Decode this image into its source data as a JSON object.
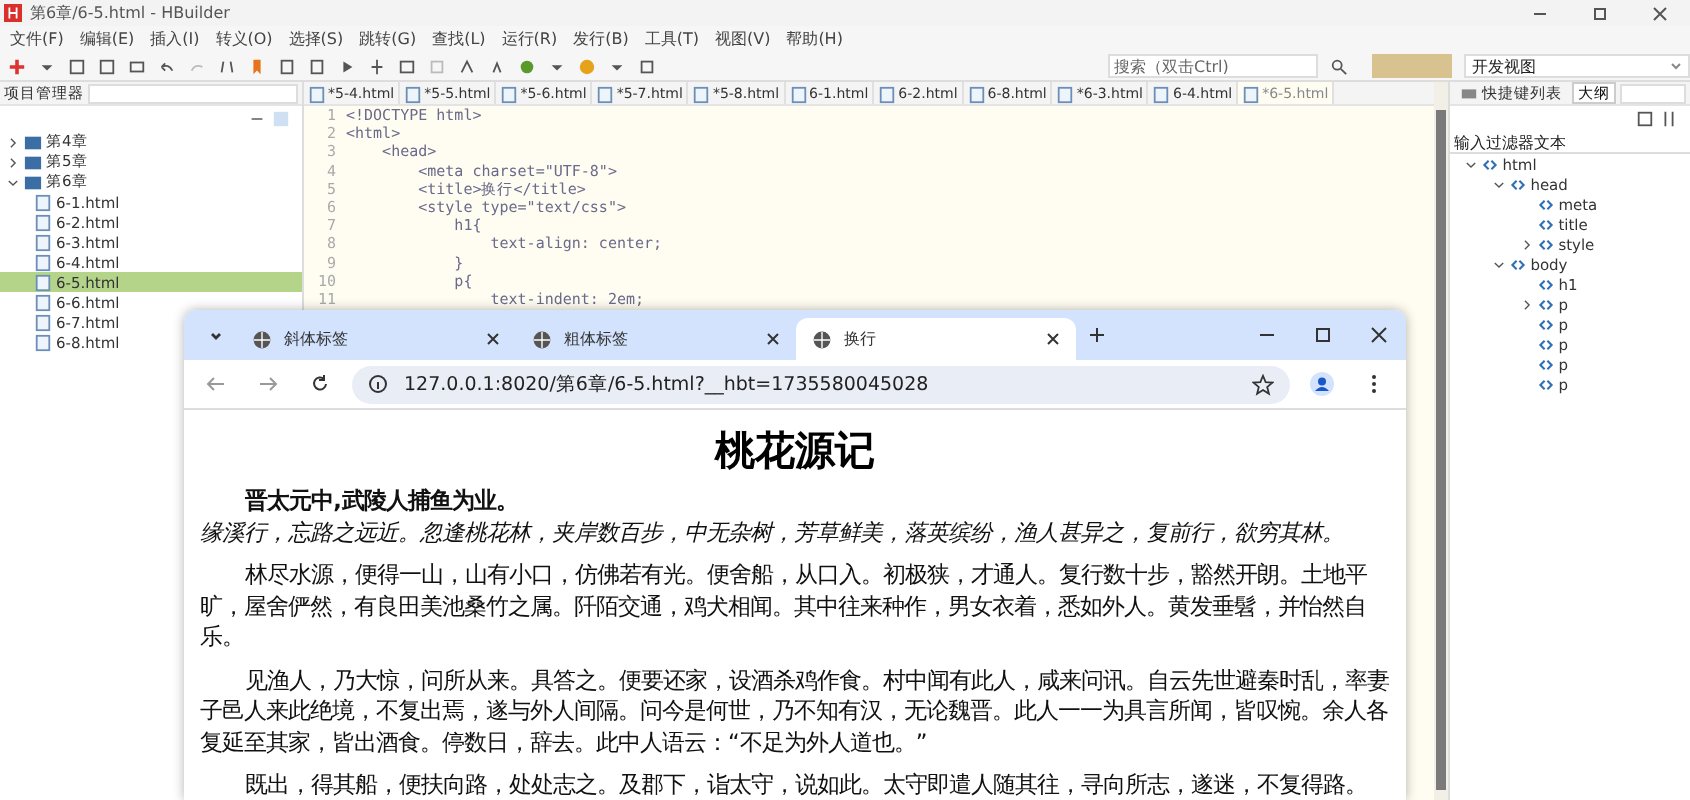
{
  "window": {
    "title": "第6章/6-5.html - HBuilder"
  },
  "menu": [
    "文件(F)",
    "编辑(E)",
    "插入(I)",
    "转义(O)",
    "选择(S)",
    "跳转(G)",
    "查找(L)",
    "运行(R)",
    "发行(B)",
    "工具(T)",
    "视图(V)",
    "帮助(H)"
  ],
  "toolbar": {
    "search": {
      "placeholder": "搜索（双击Ctrl)"
    },
    "view": "开发视图"
  },
  "project": {
    "title": "项目管理器",
    "tree": [
      {
        "label": "第4章",
        "expanded": false,
        "selected": false
      },
      {
        "label": "第5章",
        "expanded": false,
        "selected": false
      },
      {
        "label": "第6章",
        "expanded": true,
        "selected": false,
        "children": [
          {
            "label": "6-1.html",
            "selected": false
          },
          {
            "label": "6-2.html",
            "selected": false
          },
          {
            "label": "6-3.html",
            "selected": false
          },
          {
            "label": "6-4.html",
            "selected": false
          },
          {
            "label": "6-5.html",
            "selected": true
          },
          {
            "label": "6-6.html",
            "selected": false
          },
          {
            "label": "6-7.html",
            "selected": false
          },
          {
            "label": "6-8.html",
            "selected": false
          }
        ]
      }
    ]
  },
  "editor_tabs": [
    {
      "label": "*5-4.html",
      "selected": false
    },
    {
      "label": "*5-5.html",
      "selected": false
    },
    {
      "label": "*5-6.html",
      "selected": false
    },
    {
      "label": "*5-7.html",
      "selected": false
    },
    {
      "label": "*5-8.html",
      "selected": false
    },
    {
      "label": "6-1.html",
      "selected": false
    },
    {
      "label": "6-2.html",
      "selected": false
    },
    {
      "label": "6-8.html",
      "selected": false
    },
    {
      "label": "*6-3.html",
      "selected": false
    },
    {
      "label": "6-4.html",
      "selected": false
    },
    {
      "label": "*6-5.html",
      "selected": true
    }
  ],
  "code_lines": [
    {
      "number": "1",
      "text": "<!DOCTYPE html>"
    },
    {
      "number": "2",
      "text": "<html>"
    },
    {
      "number": "3",
      "text": "    <head>"
    },
    {
      "number": "4",
      "text": "        <meta charset=\"UTF-8\">"
    },
    {
      "number": "5",
      "text": "        <title>换行</title>"
    },
    {
      "number": "6",
      "text": "        <style type=\"text/css\">"
    },
    {
      "number": "7",
      "text": "            h1{"
    },
    {
      "number": "8",
      "text": "                text-align: center;"
    },
    {
      "number": "9",
      "text": "            }"
    },
    {
      "number": "10",
      "text": "            p{"
    },
    {
      "number": "11",
      "text": "                text-indent: 2em;"
    }
  ],
  "outline": {
    "tabs": [
      {
        "label": "快捷键列表",
        "selected": false
      },
      {
        "label": "大纲",
        "selected": true
      }
    ],
    "filter": {
      "placeholder": "输入过滤器文本"
    },
    "tree": [
      {
        "label": "html",
        "expanded": true,
        "children": [
          {
            "label": "head",
            "expanded": true,
            "children": [
              {
                "label": "meta"
              },
              {
                "label": "title"
              },
              {
                "label": "style",
                "expanded": false
              }
            ]
          },
          {
            "label": "body",
            "expanded": true,
            "children": [
              {
                "label": "h1"
              },
              {
                "label": "p",
                "expanded": false
              },
              {
                "label": "p"
              },
              {
                "label": "p"
              },
              {
                "label": "p"
              },
              {
                "label": "p"
              }
            ]
          }
        ]
      }
    ]
  },
  "browser": {
    "tabs": [
      {
        "label": "斜体标签",
        "selected": false
      },
      {
        "label": "粗体标签",
        "selected": false
      },
      {
        "label": "换行",
        "selected": true
      }
    ],
    "url": "127.0.0.1:8020/第6章/6-5.html?__hbt=1735580045028",
    "heading": "桃花源记",
    "paragraphs": [
      [
        {
          "text": "晋太元中,武陵人捕鱼为业。",
          "kind": "bold"
        },
        {
          "text": "缘溪行，忘路之远近。忽逢桃花林，夹岸数百步，中无杂树，芳草鲜美，落英缤纷，渔人甚异之，复前行，欲穷其林。",
          "kind": "italic"
        }
      ],
      [
        {
          "text": "林尽水源，便得一山，山有小口，仿佛若有光。便舍船，从口入。初极狭，才通人。复行数十步，豁然开朗。土地平旷，屋舍俨然，有良田美池桑竹之属。阡陌交通，鸡犬相闻。其中往来种作，男女衣着，悉如外人。黄发垂髫，并怡然自乐。",
          "kind": "normal"
        }
      ],
      [
        {
          "text": "见渔人，乃大惊，问所从来。具答之。便要还家，设酒杀鸡作食。村中闻有此人，咸来问讯。自云先世避秦时乱，率妻子邑人来此绝境，不复出焉，遂与外人间隔。问今是何世，乃不知有汉，无论魏晋。此人一一为具言所闻，皆叹惋。余人各复延至其家，皆出酒食。停数日，辞去。此中人语云：“不足为外人道也。”",
          "kind": "normal"
        }
      ],
      [
        {
          "text": "既出，得其船，便扶向路，处处志之。及郡下，诣太守，说如此。太守即遣人随其往，寻向所志，遂迷，不复得路。",
          "kind": "normal"
        }
      ]
    ]
  }
}
